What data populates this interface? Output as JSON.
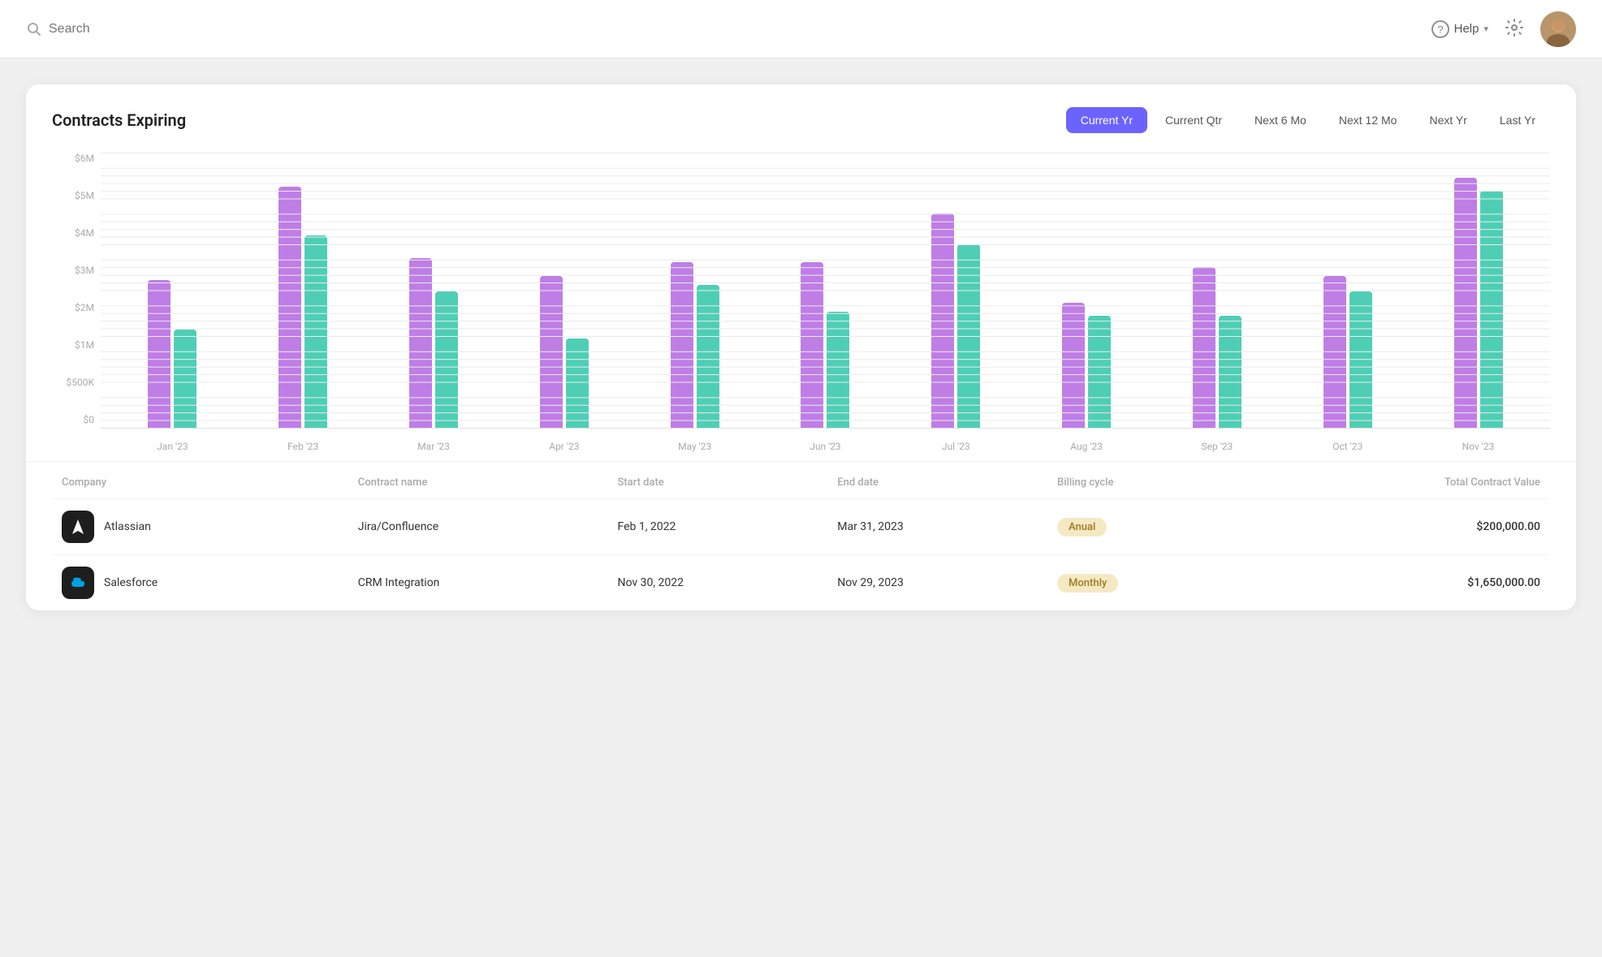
{
  "topbar": {
    "search_placeholder": "Search",
    "help_label": "Help",
    "help_chevron": "▾"
  },
  "card": {
    "title": "Contracts Expiring",
    "filters": [
      {
        "id": "current-yr",
        "label": "Current Yr",
        "active": true
      },
      {
        "id": "current-qtr",
        "label": "Current Qtr",
        "active": false
      },
      {
        "id": "next-6mo",
        "label": "Next 6 Mo",
        "active": false
      },
      {
        "id": "next-12mo",
        "label": "Next 12 Mo",
        "active": false
      },
      {
        "id": "next-yr",
        "label": "Next Yr",
        "active": false
      },
      {
        "id": "last-yr",
        "label": "Last Yr",
        "active": false
      }
    ]
  },
  "chart": {
    "y_labels": [
      "$0",
      "$500K",
      "$1M",
      "$2M",
      "$3M",
      "$4M",
      "$5M",
      "$6M"
    ],
    "max_value": 6000000,
    "months": [
      {
        "label": "Jan '23",
        "purple": 3300000,
        "teal": 2200000
      },
      {
        "label": "Feb '23",
        "purple": 5400000,
        "teal": 4300000
      },
      {
        "label": "Mar '23",
        "purple": 3800000,
        "teal": 3050000
      },
      {
        "label": "Apr '23",
        "purple": 3400000,
        "teal": 2000000
      },
      {
        "label": "May '23",
        "purple": 3700000,
        "teal": 3200000
      },
      {
        "label": "Jun '23",
        "purple": 3700000,
        "teal": 2600000
      },
      {
        "label": "Jul '23",
        "purple": 4800000,
        "teal": 4100000
      },
      {
        "label": "Aug '23",
        "purple": 2800000,
        "teal": 2500000
      },
      {
        "label": "Sep '23",
        "purple": 3600000,
        "teal": 2500000
      },
      {
        "label": "Oct '23",
        "purple": 3400000,
        "teal": 3050000
      },
      {
        "label": "Nov '23",
        "purple": 5600000,
        "teal": 5300000
      }
    ]
  },
  "table": {
    "columns": [
      {
        "key": "company",
        "label": "Company"
      },
      {
        "key": "contract_name",
        "label": "Contract name"
      },
      {
        "key": "start_date",
        "label": "Start date"
      },
      {
        "key": "end_date",
        "label": "End date"
      },
      {
        "key": "billing_cycle",
        "label": "Billing cycle"
      },
      {
        "key": "tcv",
        "label": "Total Contract Value"
      }
    ],
    "rows": [
      {
        "company": "Atlassian",
        "logo_type": "atlassian",
        "logo_icon": "▲",
        "contract_name": "Jira/Confluence",
        "start_date": "Feb 1, 2022",
        "end_date": "Mar 31, 2023",
        "billing_cycle": "Anual",
        "billing_badge": "anual",
        "tcv": "$200,000.00"
      },
      {
        "company": "Salesforce",
        "logo_type": "salesforce",
        "logo_icon": "☁",
        "contract_name": "CRM Integration",
        "start_date": "Nov 30, 2022",
        "end_date": "Nov 29, 2023",
        "billing_cycle": "Monthly",
        "billing_badge": "monthly",
        "tcv": "$1,650,000.00"
      }
    ]
  }
}
